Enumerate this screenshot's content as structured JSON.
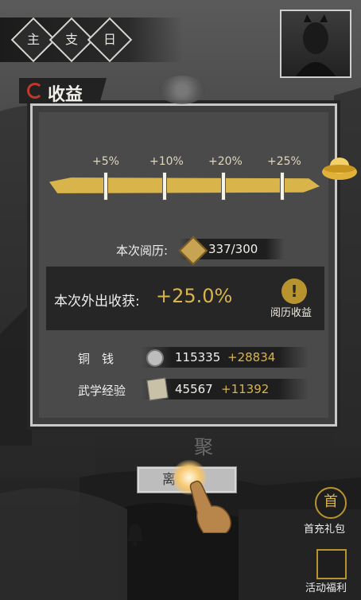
{
  "top_tabs": [
    "主",
    "支",
    "日"
  ],
  "title": "收益",
  "progress": {
    "milestones": [
      "+5%",
      "+10%",
      "+20%",
      "+25%"
    ],
    "fill_fraction": 1.0
  },
  "experience": {
    "label": "本次阅历:",
    "value": "337/300"
  },
  "outing": {
    "label": "本次外出收获:",
    "value": "+25.0%",
    "button_label": "阅历收益",
    "button_glyph": "!"
  },
  "rewards": [
    {
      "label": "铜　钱",
      "value": "115335",
      "bonus": "+28834",
      "icon": "coin-icon"
    },
    {
      "label": "武学经验",
      "value": "45567",
      "bonus": "+11392",
      "icon": "manual-icon"
    }
  ],
  "gather_char": "聚",
  "leave_button": "离开",
  "side_buttons": {
    "first_recharge": "首充礼包",
    "first_recharge_glyph": "首",
    "activity": "活动福利"
  },
  "colors": {
    "accent_gold": "#d9b44a",
    "panel": "#4a4a4a",
    "title_icon": "#c0392b"
  }
}
